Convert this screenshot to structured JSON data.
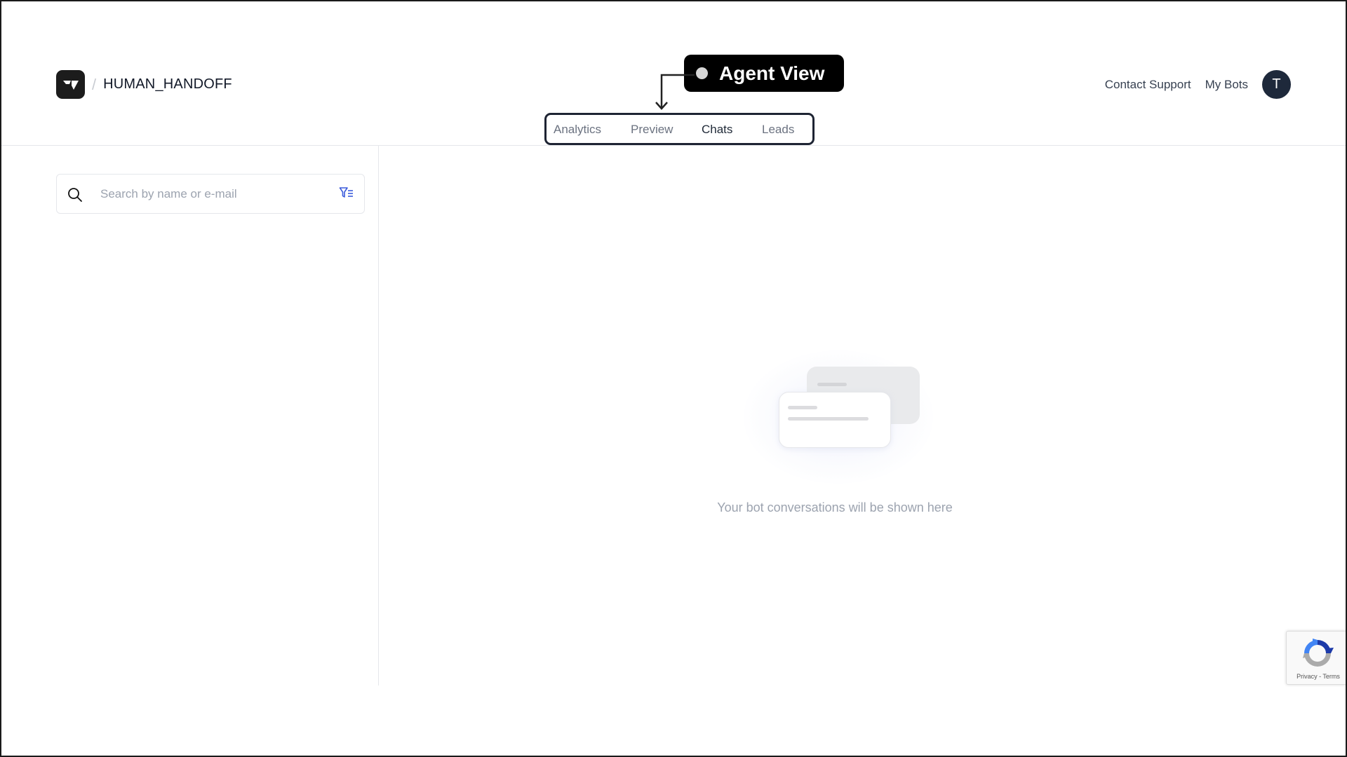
{
  "header": {
    "bot_name": "HUMAN_HANDOFF",
    "separator": "/",
    "tabs": [
      {
        "label": "Analytics",
        "active": false
      },
      {
        "label": "Preview",
        "active": false
      },
      {
        "label": "Chats",
        "active": true
      },
      {
        "label": "Leads",
        "active": false
      }
    ],
    "nav_links": {
      "contact_support": "Contact Support",
      "my_bots": "My Bots"
    },
    "avatar_initial": "T"
  },
  "annotation": {
    "label": "Agent View",
    "color": "#000000"
  },
  "sidebar": {
    "search": {
      "placeholder": "Search by name or e-mail",
      "value": ""
    },
    "icons": {
      "search": "search-icon",
      "filter": "filter-list-icon"
    }
  },
  "main": {
    "empty_state_text": "Your bot conversations will be shown here",
    "illustration": "chat-cards-illustration"
  },
  "recaptcha": {
    "links": "Privacy - Terms"
  },
  "colors": {
    "accent": "#3b5bdb",
    "avatar_bg": "#1e293b",
    "logo_bg": "#1c1c1c"
  }
}
